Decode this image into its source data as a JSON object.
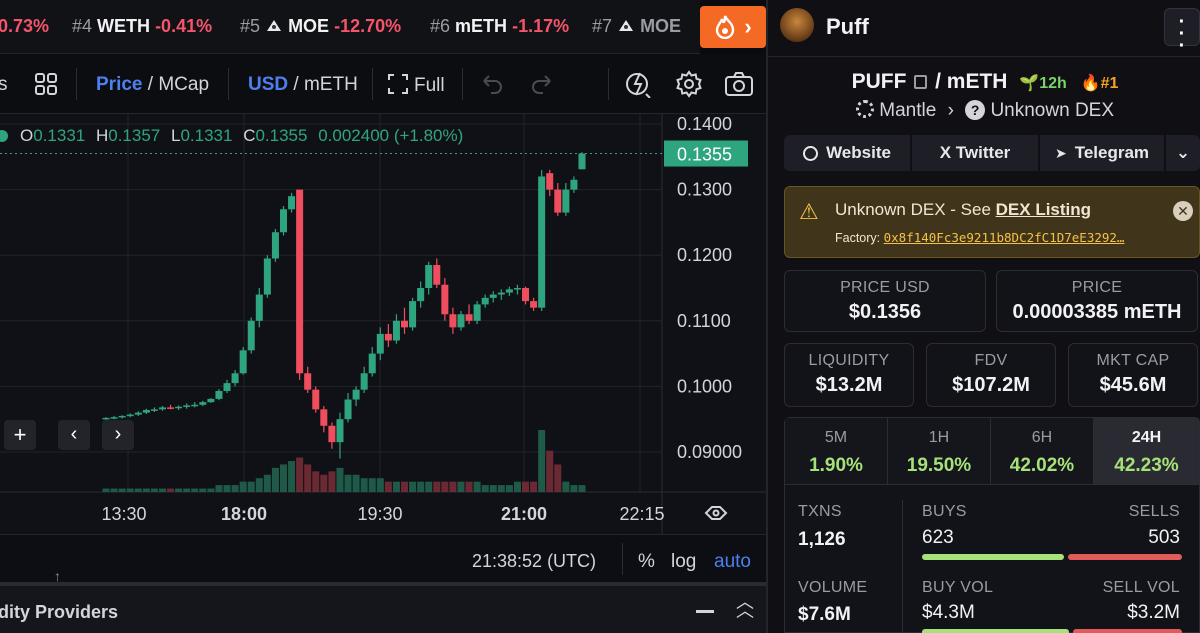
{
  "ticker": [
    {
      "rank": "",
      "symbol": "",
      "change": "0.73%",
      "icon": ""
    },
    {
      "rank": "#4",
      "symbol": "WETH",
      "change": "-0.41%",
      "icon": ""
    },
    {
      "rank": "#5",
      "symbol": "MOE",
      "change": "-12.70%",
      "icon": "ninja-token-icon"
    },
    {
      "rank": "#6",
      "symbol": "mETH",
      "change": "-1.17%",
      "icon": ""
    },
    {
      "rank": "#7",
      "symbol": "MOE",
      "change": "",
      "icon": "ninja-token-icon"
    }
  ],
  "hot_button": {
    "icon": "flame-icon",
    "chevron": "›"
  },
  "toolbar": {
    "partial": "s",
    "price": "Price",
    "mcap": "MCap",
    "usd": "USD",
    "meth": "mETH",
    "full": "Full"
  },
  "ohlc": {
    "o": "0.1331",
    "h": "0.1357",
    "l": "0.1331",
    "c": "0.1355",
    "change": "0.002400 (+1.80%)"
  },
  "price_axis": [
    "0.1400",
    "0.1300",
    "0.1200",
    "0.1100",
    "0.1000",
    "0.09000"
  ],
  "current_price_label": "0.1355",
  "time_axis": [
    "13:30",
    "18:00",
    "19:30",
    "21:00",
    "22:15"
  ],
  "footer": {
    "clock": "21:38:52 (UTC)",
    "percent": "%",
    "log": "log",
    "auto": "auto",
    "bottom_tab": "dity Providers"
  },
  "chart_data": {
    "type": "candlestick",
    "ylim": [
      0.085,
      0.14
    ],
    "candles": [
      [
        0.0951,
        0.0953,
        0.0949,
        0.0952
      ],
      [
        0.0952,
        0.0955,
        0.095,
        0.0953
      ],
      [
        0.0953,
        0.0956,
        0.0951,
        0.0955
      ],
      [
        0.0955,
        0.0959,
        0.0953,
        0.0957
      ],
      [
        0.0957,
        0.0962,
        0.0955,
        0.096
      ],
      [
        0.096,
        0.0966,
        0.0958,
        0.0964
      ],
      [
        0.0964,
        0.0968,
        0.0961,
        0.0965
      ],
      [
        0.0965,
        0.097,
        0.0963,
        0.0968
      ],
      [
        0.0968,
        0.0972,
        0.0965,
        0.0967
      ],
      [
        0.0967,
        0.0971,
        0.0964,
        0.0969
      ],
      [
        0.0969,
        0.0974,
        0.0966,
        0.0971
      ],
      [
        0.0971,
        0.0976,
        0.0968,
        0.0972
      ],
      [
        0.0972,
        0.0978,
        0.097,
        0.0976
      ],
      [
        0.0976,
        0.0982,
        0.0975,
        0.0981
      ],
      [
        0.0981,
        0.0996,
        0.0979,
        0.0993
      ],
      [
        0.0993,
        0.101,
        0.099,
        0.1005
      ],
      [
        0.1005,
        0.1025,
        0.1,
        0.102
      ],
      [
        0.102,
        0.106,
        0.1018,
        0.1055
      ],
      [
        0.1055,
        0.1105,
        0.105,
        0.11
      ],
      [
        0.11,
        0.115,
        0.109,
        0.114
      ],
      [
        0.114,
        0.12,
        0.1135,
        0.1195
      ],
      [
        0.1195,
        0.124,
        0.119,
        0.1235
      ],
      [
        0.1235,
        0.1275,
        0.123,
        0.127
      ],
      [
        0.127,
        0.1295,
        0.1265,
        0.129
      ],
      [
        0.13,
        0.13,
        0.101,
        0.102
      ],
      [
        0.102,
        0.103,
        0.099,
        0.0995
      ],
      [
        0.0995,
        0.1,
        0.096,
        0.0965
      ],
      [
        0.0965,
        0.097,
        0.093,
        0.094
      ],
      [
        0.094,
        0.0945,
        0.0905,
        0.0915
      ],
      [
        0.0915,
        0.096,
        0.089,
        0.095
      ],
      [
        0.095,
        0.099,
        0.0945,
        0.098
      ],
      [
        0.098,
        0.1,
        0.097,
        0.0995
      ],
      [
        0.0995,
        0.103,
        0.099,
        0.102
      ],
      [
        0.102,
        0.106,
        0.1015,
        0.105
      ],
      [
        0.105,
        0.109,
        0.104,
        0.108
      ],
      [
        0.108,
        0.1095,
        0.106,
        0.107
      ],
      [
        0.107,
        0.111,
        0.1065,
        0.11
      ],
      [
        0.11,
        0.112,
        0.108,
        0.109
      ],
      [
        0.109,
        0.1135,
        0.1085,
        0.113
      ],
      [
        0.113,
        0.116,
        0.112,
        0.115
      ],
      [
        0.115,
        0.119,
        0.114,
        0.1185
      ],
      [
        0.1185,
        0.1195,
        0.115,
        0.1155
      ],
      [
        0.1155,
        0.1165,
        0.11,
        0.111
      ],
      [
        0.111,
        0.112,
        0.108,
        0.109
      ],
      [
        0.109,
        0.1115,
        0.1085,
        0.111
      ],
      [
        0.111,
        0.1125,
        0.1095,
        0.11
      ],
      [
        0.11,
        0.113,
        0.1095,
        0.1125
      ],
      [
        0.1125,
        0.114,
        0.112,
        0.1135
      ],
      [
        0.1135,
        0.1145,
        0.1128,
        0.114
      ],
      [
        0.114,
        0.1148,
        0.1132,
        0.1143
      ],
      [
        0.1143,
        0.1152,
        0.1138,
        0.1148
      ],
      [
        0.1148,
        0.1155,
        0.114,
        0.115
      ],
      [
        0.115,
        0.1152,
        0.1125,
        0.113
      ],
      [
        0.113,
        0.1135,
        0.1115,
        0.112
      ],
      [
        0.112,
        0.133,
        0.1115,
        0.132
      ],
      [
        0.1325,
        0.133,
        0.129,
        0.13
      ],
      [
        0.13,
        0.131,
        0.126,
        0.1265
      ],
      [
        0.1265,
        0.131,
        0.126,
        0.13
      ],
      [
        0.13,
        0.132,
        0.1295,
        0.1315
      ],
      [
        0.1331,
        0.1357,
        0.1331,
        0.1355
      ]
    ],
    "volumes": [
      1,
      1,
      1,
      1,
      1,
      1,
      1,
      1,
      1,
      1,
      1,
      1,
      1,
      1,
      2,
      2,
      2,
      3,
      3,
      4,
      5,
      7,
      8,
      9,
      10,
      8,
      6,
      5,
      6,
      7,
      5,
      5,
      4,
      4,
      4,
      3,
      3,
      3,
      3,
      3,
      3,
      3,
      3,
      3,
      3,
      3,
      3,
      2,
      2,
      2,
      2,
      3,
      3,
      3,
      18,
      12,
      8,
      3,
      2,
      2
    ]
  },
  "panel": {
    "avatar": "puff-avatar",
    "name": "Puff",
    "pair_base": "PUFF",
    "pair_sep": "/",
    "pair_quote": "mETH",
    "age": "12h",
    "rank": "#1",
    "chain": "Mantle",
    "dex": "Unknown DEX",
    "social": [
      "Website",
      "X  Twitter",
      "Telegram"
    ],
    "warning": {
      "text": "Unknown DEX - See ",
      "link": "DEX Listing",
      "factory_label": "Factory: ",
      "factory": "0x8f140Fc3e9211b8DC2fC1D7eE3292…"
    },
    "price_usd": {
      "label": "PRICE USD",
      "value": "$0.1356"
    },
    "price": {
      "label": "PRICE",
      "value": "0.00003385 mETH"
    },
    "liquidity": {
      "label": "LIQUIDITY",
      "value": "$13.2M"
    },
    "fdv": {
      "label": "FDV",
      "value": "$107.2M"
    },
    "mktcap": {
      "label": "MKT CAP",
      "value": "$45.6M"
    },
    "timeframes": [
      {
        "label": "5M",
        "value": "1.90%"
      },
      {
        "label": "1H",
        "value": "19.50%"
      },
      {
        "label": "6H",
        "value": "42.02%"
      },
      {
        "label": "24H",
        "value": "42.23%"
      }
    ],
    "stats": {
      "txns_label": "TXNS",
      "txns": "1,126",
      "buys_label": "BUYS",
      "buys": "623",
      "sells_label": "SELLS",
      "sells": "503",
      "buys_ratio": 0.553,
      "volume_label": "VOLUME",
      "volume": "$7.6M",
      "buyvol_label": "BUY VOL",
      "buyvol": "$4.3M",
      "sellvol_label": "SELL VOL",
      "sellvol": "$3.2M",
      "buyvol_ratio": 0.573
    },
    "colors": {
      "green": "#a6e17a",
      "red": "#e15b5b",
      "up": "#2fa57f",
      "down": "#f04e5e",
      "accent": "#4e7ff0"
    }
  }
}
